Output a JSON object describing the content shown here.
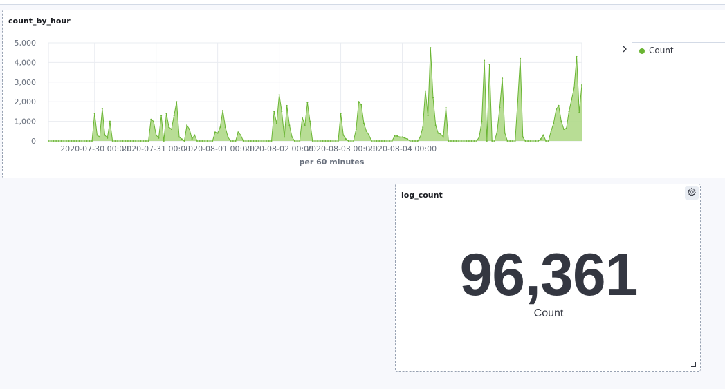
{
  "panels": {
    "chart": {
      "title": "count_by_hour"
    },
    "metric": {
      "title": "log_count",
      "value": "96,361",
      "label": "Count"
    }
  },
  "legend": {
    "items": [
      {
        "label": "Count",
        "color": "#54b399"
      }
    ]
  },
  "colors": {
    "series_fill": "#b0d98a",
    "series_line": "#6ab533",
    "legend_dot": "#6ab533"
  },
  "icons": {
    "legend_toggle": "chevron-right-icon",
    "settings": "gear-icon",
    "resize": "resize-icon"
  },
  "chart_data": {
    "type": "area",
    "title": "count_by_hour",
    "xlabel": "per 60 minutes",
    "ylabel": "",
    "ylim": [
      0,
      5000
    ],
    "yticks": [
      0,
      1000,
      2000,
      3000,
      4000,
      5000
    ],
    "ytick_labels": [
      "0",
      "1,000",
      "2,000",
      "3,000",
      "4,000",
      "5,000"
    ],
    "xtick_labels": [
      "2020-07-30 00:00",
      "2020-07-31 00:00",
      "2020-08-01 00:00",
      "2020-08-02 00:00",
      "2020-08-03 00:00",
      "2020-08-04 00:00"
    ],
    "x_start": "2020-07-29 06:00",
    "x_end": "2020-08-04 23:00",
    "interval": "60 minutes",
    "grid": true,
    "legend_position": "right",
    "series": [
      {
        "name": "Count",
        "values": [
          0,
          0,
          0,
          0,
          0,
          0,
          0,
          0,
          0,
          0,
          0,
          0,
          0,
          0,
          0,
          0,
          0,
          0,
          1400,
          300,
          200,
          1650,
          300,
          150,
          1000,
          0,
          0,
          0,
          0,
          0,
          0,
          0,
          0,
          0,
          0,
          0,
          0,
          0,
          0,
          0,
          1100,
          1000,
          300,
          150,
          1300,
          0,
          1400,
          700,
          600,
          1300,
          2000,
          200,
          100,
          0,
          800,
          600,
          100,
          300,
          0,
          0,
          0,
          0,
          0,
          0,
          0,
          450,
          400,
          700,
          1550,
          700,
          200,
          0,
          0,
          0,
          450,
          300,
          0,
          0,
          0,
          0,
          0,
          0,
          0,
          0,
          0,
          0,
          0,
          0,
          1500,
          900,
          2350,
          1500,
          200,
          1800,
          800,
          200,
          0,
          0,
          0,
          1200,
          800,
          1950,
          1000,
          0,
          0,
          0,
          0,
          0,
          0,
          0,
          0,
          0,
          0,
          0,
          1400,
          300,
          100,
          0,
          0,
          0,
          600,
          2000,
          1850,
          900,
          500,
          300,
          0,
          0,
          0,
          0,
          0,
          0,
          0,
          0,
          0,
          250,
          250,
          200,
          200,
          150,
          100,
          0,
          0,
          0,
          0,
          200,
          700,
          2550,
          1300,
          4750,
          2200,
          800,
          400,
          350,
          200,
          1700,
          0,
          0,
          0,
          0,
          0,
          0,
          0,
          0,
          0,
          0,
          0,
          0,
          200,
          1000,
          4100,
          0,
          3900,
          0,
          0,
          500,
          1700,
          3200,
          400,
          0,
          0,
          0,
          0,
          2000,
          4200,
          200,
          0,
          0,
          0,
          0,
          0,
          0,
          100,
          300,
          0,
          0,
          500,
          900,
          1600,
          1800,
          1000,
          600,
          650,
          1500,
          2100,
          2700,
          4300,
          1450,
          2850
        ]
      }
    ]
  }
}
